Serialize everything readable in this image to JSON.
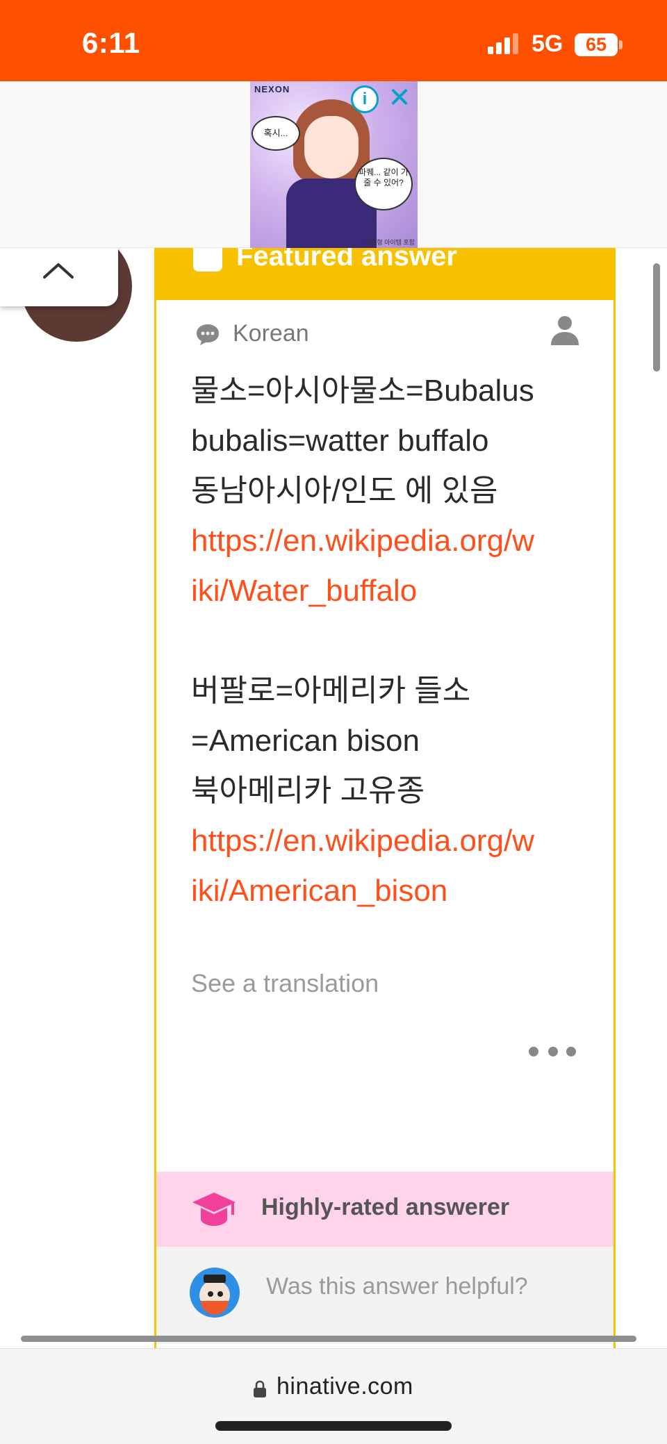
{
  "status_bar": {
    "time": "6:11",
    "network": "5G",
    "battery": "65",
    "battery_level_percent": 65,
    "signal_bars": 3,
    "color": "#ff5000"
  },
  "ad": {
    "brand": "NEXON",
    "bubble_1": "혹시...",
    "bubble_2": "파퀘... 같이 가줄 수 있어?",
    "footer": "확률형 아이템 포함",
    "info_icon": "info-icon",
    "close_icon": "close-icon"
  },
  "answer": {
    "featured_label": "Featured answer",
    "language": "Korean",
    "lines": [
      {
        "text": "물소=아시아물소=Bubalus",
        "link": false
      },
      {
        "text": "bubalis=watter buffalo",
        "link": false
      },
      {
        "text": "동남아시아/인도 에 있음",
        "link": false
      },
      {
        "text": "https://en.wikipedia.org/w",
        "link": true
      },
      {
        "text": "iki/Water_buffalo",
        "link": true
      },
      {
        "text": "",
        "link": false
      },
      {
        "text": "버팔로=아메리카 들소",
        "link": false
      },
      {
        "text": "=American bison",
        "link": false
      },
      {
        "text": "북아메리카 고유종",
        "link": false
      },
      {
        "text": "https://en.wikipedia.org/w",
        "link": true
      },
      {
        "text": "iki/American_bison",
        "link": true
      }
    ],
    "see_translation": "See a translation",
    "badge": "Highly-rated answerer",
    "helpful_prompt": "Was this answer helpful?",
    "accent_color": "#f7c100",
    "link_color": "#ff4f1a",
    "badge_color": "#ffd3ea"
  },
  "browser": {
    "url": "hinative.com"
  }
}
